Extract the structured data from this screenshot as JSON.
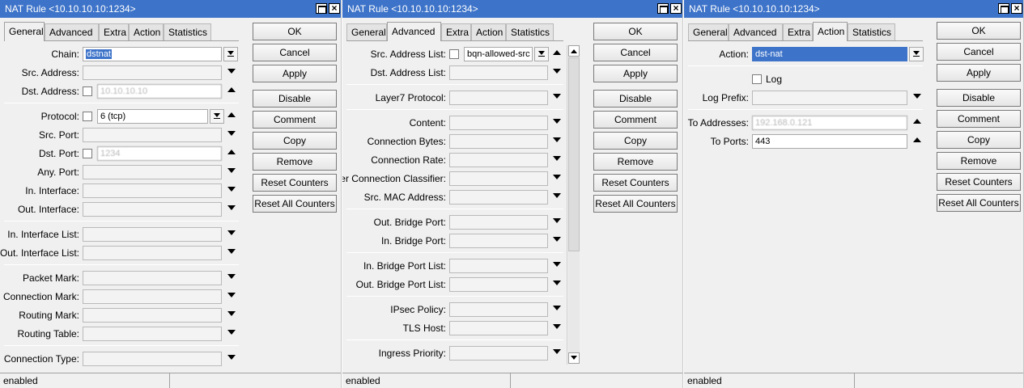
{
  "windows": [
    {
      "title": "NAT Rule <10.10.10.10:1234>",
      "tabs": [
        "General",
        "Advanced",
        "Extra",
        "Action",
        "Statistics"
      ],
      "active_tab": "General",
      "fields": [
        {
          "label": "Chain:",
          "value": "dstnat"
        },
        {
          "label": "Src. Address:",
          "value": ""
        },
        {
          "label": "Dst. Address:",
          "value": "10.10.10.10"
        },
        {
          "label": "Protocol:",
          "value": "6 (tcp)"
        },
        {
          "label": "Src. Port:",
          "value": ""
        },
        {
          "label": "Dst. Port:",
          "value": "1234"
        },
        {
          "label": "Any. Port:",
          "value": ""
        },
        {
          "label": "In. Interface:",
          "value": ""
        },
        {
          "label": "Out. Interface:",
          "value": ""
        },
        {
          "label": "In. Interface List:",
          "value": ""
        },
        {
          "label": "Out. Interface List:",
          "value": ""
        },
        {
          "label": "Packet Mark:",
          "value": ""
        },
        {
          "label": "Connection Mark:",
          "value": ""
        },
        {
          "label": "Routing Mark:",
          "value": ""
        },
        {
          "label": "Routing Table:",
          "value": ""
        },
        {
          "label": "Connection Type:",
          "value": ""
        }
      ],
      "status": "enabled"
    },
    {
      "title": "NAT Rule <10.10.10.10:1234>",
      "tabs": [
        "General",
        "Advanced",
        "Extra",
        "Action",
        "Statistics"
      ],
      "active_tab": "Advanced",
      "fields": [
        {
          "label": "Src. Address List:",
          "value": "bqn-allowed-src"
        },
        {
          "label": "Dst. Address List:",
          "value": ""
        },
        {
          "label": "Layer7 Protocol:",
          "value": ""
        },
        {
          "label": "Content:",
          "value": ""
        },
        {
          "label": "Connection Bytes:",
          "value": ""
        },
        {
          "label": "Connection Rate:",
          "value": ""
        },
        {
          "label": "Per Connection Classifier:",
          "value": ""
        },
        {
          "label": "Src. MAC Address:",
          "value": ""
        },
        {
          "label": "Out. Bridge Port:",
          "value": ""
        },
        {
          "label": "In. Bridge Port:",
          "value": ""
        },
        {
          "label": "In. Bridge Port List:",
          "value": ""
        },
        {
          "label": "Out. Bridge Port List:",
          "value": ""
        },
        {
          "label": "IPsec Policy:",
          "value": ""
        },
        {
          "label": "TLS Host:",
          "value": ""
        },
        {
          "label": "Ingress Priority:",
          "value": ""
        }
      ],
      "status": "enabled"
    },
    {
      "title": "NAT Rule <10.10.10.10:1234>",
      "tabs": [
        "General",
        "Advanced",
        "Extra",
        "Action",
        "Statistics"
      ],
      "active_tab": "Action",
      "fields": [
        {
          "label": "Action:",
          "value": "dst-nat"
        },
        {
          "label": "Log",
          "value": ""
        },
        {
          "label": "Log Prefix:",
          "value": ""
        },
        {
          "label": "To Addresses:",
          "value": "192.168.0.121"
        },
        {
          "label": "To Ports:",
          "value": "443"
        }
      ],
      "status": "enabled"
    }
  ],
  "buttons": [
    "OK",
    "Cancel",
    "Apply",
    "Disable",
    "Comment",
    "Copy",
    "Remove",
    "Reset Counters",
    "Reset All Counters"
  ],
  "colors": {
    "titlebar": "#3d73c9",
    "selection": "#3d73c9",
    "background": "#f0f0f0"
  }
}
